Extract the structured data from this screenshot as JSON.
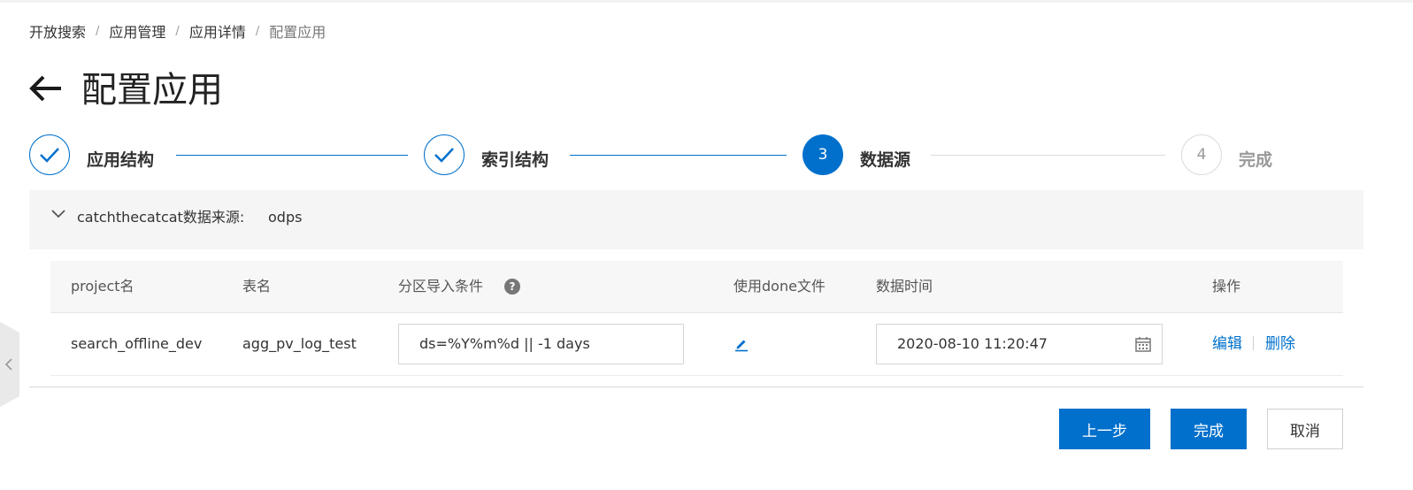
{
  "breadcrumb": [
    "开放搜索",
    "应用管理",
    "应用详情",
    "配置应用"
  ],
  "breadcrumb_separator": "/",
  "page": {
    "title": "配置应用"
  },
  "steps": [
    {
      "label": "应用结构",
      "status": "done"
    },
    {
      "label": "索引结构",
      "status": "done"
    },
    {
      "label": "数据源",
      "status": "active",
      "number": "3"
    },
    {
      "label": "完成",
      "status": "pending",
      "number": "4"
    }
  ],
  "datasource": {
    "label": "catchthecatcat数据来源:",
    "value": "odps"
  },
  "table": {
    "columns": {
      "project": "project名",
      "table": "表名",
      "partition": "分区导入条件",
      "done_file": "使用done文件",
      "data_time": "数据时间",
      "actions": "操作"
    },
    "rows": [
      {
        "project": "search_offline_dev",
        "table": "agg_pv_log_test",
        "partition": "ds=%Y%m%d || -1 days",
        "data_time": "2020-08-10 11:20:47",
        "edit": "编辑",
        "delete": "删除"
      }
    ]
  },
  "buttons": {
    "prev": "上一步",
    "finish": "完成",
    "cancel": "取消"
  },
  "colors": {
    "primary": "#0070cc",
    "panel_bg": "#f5f5f5",
    "pending": "#dcdcdc"
  }
}
